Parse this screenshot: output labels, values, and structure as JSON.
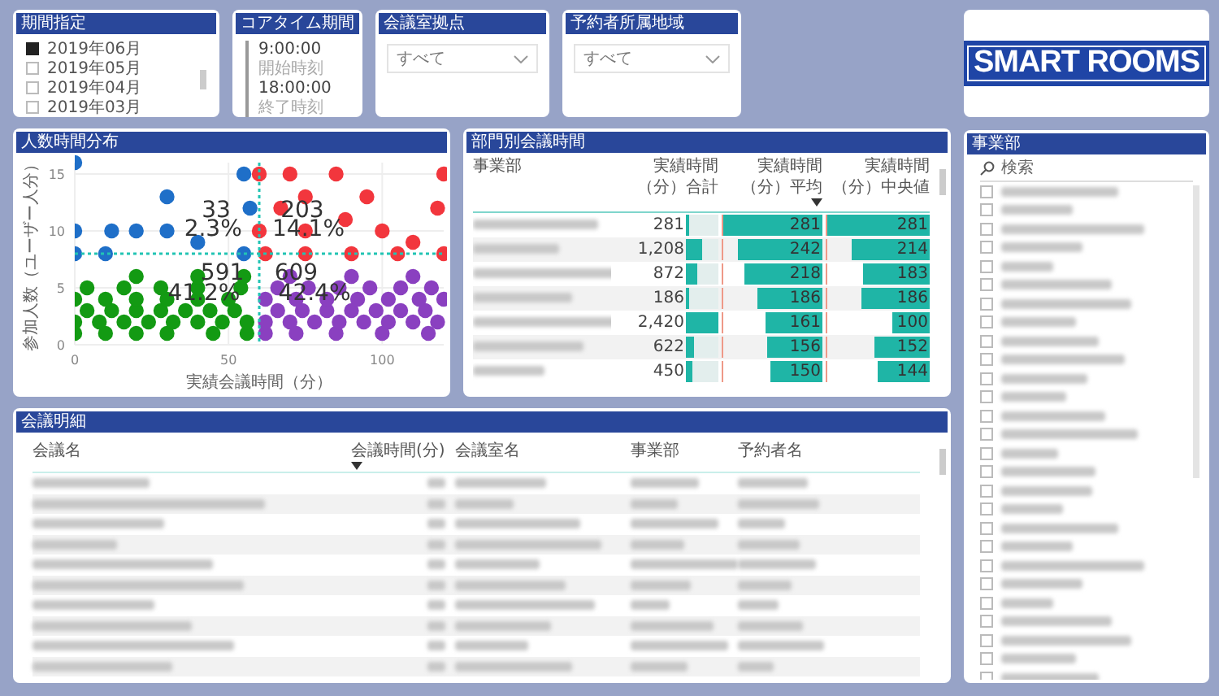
{
  "period_slicer": {
    "title": "期間指定",
    "items": [
      {
        "label": "2019年06月",
        "checked": true
      },
      {
        "label": "2019年05月",
        "checked": false
      },
      {
        "label": "2019年04月",
        "checked": false
      },
      {
        "label": "2019年03月",
        "checked": false
      }
    ]
  },
  "core_time": {
    "title": "コアタイム期間",
    "entries": [
      {
        "value": "9:00:00",
        "label": "開始時刻"
      },
      {
        "value": "18:00:00",
        "label": "終了時刻"
      }
    ]
  },
  "dropdowns": [
    {
      "title": "会議室拠点",
      "value": "すべて"
    },
    {
      "title": "予約者所属地域",
      "value": "すべて"
    }
  ],
  "logo": "SMART ROOMS",
  "scatter_panel": {
    "title": "人数時間分布",
    "chart_data": {
      "type": "scatter",
      "xlabel": "実績会議時間（分）",
      "ylabel": "参加人数（ユーザー人分）",
      "xlim": [
        0,
        120
      ],
      "ylim": [
        0,
        16
      ],
      "xticks": [
        0,
        50,
        100
      ],
      "yticks": [
        0,
        5,
        10,
        15
      ],
      "x": [
        0,
        0,
        0,
        10,
        12,
        20,
        30,
        30,
        40,
        55,
        57,
        55,
        60,
        70,
        85,
        120,
        75,
        95,
        60,
        67,
        75,
        88,
        100,
        110,
        118,
        62,
        75,
        90,
        105,
        120,
        0,
        10,
        20,
        30,
        45,
        56,
        0,
        8,
        16,
        24,
        32,
        40,
        48,
        56,
        4,
        12,
        20,
        28,
        36,
        44,
        52,
        0,
        10,
        20,
        30,
        40,
        50,
        4,
        16,
        28,
        40,
        54,
        20,
        40,
        55,
        62,
        72,
        85,
        100,
        115,
        62,
        70,
        78,
        86,
        94,
        102,
        110,
        118,
        66,
        74,
        82,
        90,
        98,
        106,
        114,
        62,
        72,
        82,
        92,
        102,
        112,
        120,
        66,
        76,
        86,
        96,
        106,
        116,
        70,
        90,
        110
      ],
      "series": [
        {
          "color": "#1f6fc8",
          "values": [
            16,
            10,
            8,
            8,
            10,
            10,
            13,
            10,
            9,
            15,
            12,
            8,
            null,
            null,
            null,
            null,
            null,
            null,
            null,
            null,
            null,
            null,
            null,
            null,
            null,
            null,
            null,
            null,
            null,
            null,
            null,
            null,
            null,
            null,
            null,
            null,
            null,
            null,
            null,
            null,
            null,
            null,
            null,
            null,
            null,
            null,
            null,
            null,
            null,
            null,
            null,
            null,
            null,
            null,
            null,
            null,
            null,
            null,
            null,
            null,
            null,
            null,
            null,
            null,
            null,
            null,
            null,
            null,
            null,
            null,
            null,
            null,
            null,
            null,
            null,
            null,
            null,
            null,
            null,
            null,
            null,
            null,
            null,
            null,
            null,
            null,
            null,
            null,
            null,
            null,
            null,
            null,
            null,
            null,
            null,
            null,
            null,
            null,
            null,
            null,
            null
          ]
        },
        {
          "color": "#f2363d",
          "values": [
            null,
            null,
            null,
            null,
            null,
            null,
            null,
            null,
            null,
            null,
            null,
            null,
            15,
            15,
            15,
            15,
            13,
            13,
            10,
            12,
            10,
            11,
            10,
            9,
            12,
            8,
            8,
            8,
            8,
            8,
            null,
            null,
            null,
            null,
            null,
            null,
            null,
            null,
            null,
            null,
            null,
            null,
            null,
            null,
            null,
            null,
            null,
            null,
            null,
            null,
            null,
            null,
            null,
            null,
            null,
            null,
            null,
            null,
            null,
            null,
            null,
            null,
            null,
            null,
            null,
            null,
            null,
            null,
            null,
            null,
            null,
            null,
            null,
            null,
            null,
            null,
            null,
            null,
            null,
            null,
            null,
            null,
            null,
            null,
            null,
            null,
            null,
            null,
            null,
            null,
            null,
            null,
            null,
            null,
            null,
            null,
            null,
            null,
            null,
            null,
            null
          ]
        },
        {
          "color": "#139a13",
          "values": [
            null,
            null,
            null,
            null,
            null,
            null,
            null,
            null,
            null,
            null,
            null,
            null,
            null,
            null,
            null,
            null,
            null,
            null,
            null,
            null,
            null,
            null,
            null,
            null,
            null,
            null,
            null,
            null,
            null,
            null,
            1,
            1,
            1,
            1,
            1,
            1,
            2,
            2,
            2,
            2,
            2,
            2,
            2,
            2,
            3,
            3,
            3,
            3,
            3,
            3,
            3,
            4,
            4,
            4,
            4,
            4,
            4,
            5,
            5,
            5,
            5,
            5,
            6,
            6,
            6,
            null,
            null,
            null,
            null,
            null,
            null,
            null,
            null,
            null,
            null,
            null,
            null,
            null,
            null,
            null,
            null,
            null,
            null,
            null,
            null,
            null,
            null,
            null,
            null,
            null,
            null,
            null,
            null,
            null,
            null,
            null,
            null,
            null,
            null,
            null,
            null
          ]
        },
        {
          "color": "#8a40c0",
          "values": [
            null,
            null,
            null,
            null,
            null,
            null,
            null,
            null,
            null,
            null,
            null,
            null,
            null,
            null,
            null,
            null,
            null,
            null,
            null,
            null,
            null,
            null,
            null,
            null,
            null,
            null,
            null,
            null,
            null,
            null,
            null,
            null,
            null,
            null,
            null,
            null,
            null,
            null,
            null,
            null,
            null,
            null,
            null,
            null,
            null,
            null,
            null,
            null,
            null,
            null,
            null,
            null,
            null,
            null,
            null,
            null,
            null,
            null,
            null,
            null,
            null,
            null,
            null,
            null,
            null,
            1,
            1,
            1,
            1,
            1,
            2,
            2,
            2,
            2,
            2,
            2,
            2,
            2,
            3,
            3,
            3,
            3,
            3,
            3,
            3,
            4,
            4,
            4,
            4,
            4,
            4,
            4,
            5,
            5,
            5,
            5,
            5,
            5,
            6,
            6,
            6
          ]
        }
      ],
      "grid": true,
      "ref_lines": [
        {
          "axis": "x",
          "value": 60
        },
        {
          "axis": "y",
          "value": 8
        }
      ],
      "annotations": [
        "33",
        "2.3%",
        "203",
        "14.1%",
        "591",
        "41.2%",
        "609",
        "42.4%"
      ]
    }
  },
  "dept_table": {
    "title": "部門別会議時間",
    "columns": [
      {
        "label": "事業部",
        "sorted": false
      },
      {
        "label": "実績時間（分）合計",
        "sorted": false
      },
      {
        "label": "実績時間（分）平均",
        "sorted": true
      },
      {
        "label": "実績時間（分）中央値",
        "sorted": false
      }
    ],
    "rows": [
      {
        "total": {
          "text": "281",
          "level": 0.12
        },
        "average": {
          "text": "281",
          "level": 1
        },
        "median": {
          "text": "281",
          "level": 1
        }
      },
      {
        "total": {
          "text": "1,208",
          "level": 0.5
        },
        "average": {
          "text": "242",
          "level": 0.86
        },
        "median": {
          "text": "214",
          "level": 0.76
        }
      },
      {
        "total": {
          "text": "872",
          "level": 0.36
        },
        "average": {
          "text": "218",
          "level": 0.78
        },
        "median": {
          "text": "183",
          "level": 0.65
        }
      },
      {
        "total": {
          "text": "186",
          "level": 0.08
        },
        "average": {
          "text": "186",
          "level": 0.66
        },
        "median": {
          "text": "186",
          "level": 0.66
        }
      },
      {
        "total": {
          "text": "2,420",
          "level": 1
        },
        "average": {
          "text": "161",
          "level": 0.57
        },
        "median": {
          "text": "100",
          "level": 0.36
        }
      },
      {
        "total": {
          "text": "622",
          "level": 0.26
        },
        "average": {
          "text": "156",
          "level": 0.56
        },
        "median": {
          "text": "152",
          "level": 0.54
        }
      },
      {
        "total": {
          "text": "450",
          "level": 0.19
        },
        "average": {
          "text": "150",
          "level": 0.53
        },
        "median": {
          "text": "144",
          "level": 0.51
        }
      }
    ]
  },
  "detail_table": {
    "title": "会議明細",
    "columns": [
      {
        "label": "会議名",
        "sorted": false
      },
      {
        "label": "会議時間(分)",
        "sorted": true
      },
      {
        "label": "会議室名",
        "sorted": false
      },
      {
        "label": "事業部",
        "sorted": false
      },
      {
        "label": "予約者名",
        "sorted": false
      }
    ]
  },
  "department_slicer": {
    "title": "事業部",
    "search": {
      "placeholder": "検索"
    },
    "items": [
      {
        "checked": false
      },
      {
        "checked": false
      },
      {
        "checked": false
      },
      {
        "checked": false
      },
      {
        "checked": false
      },
      {
        "checked": false
      },
      {
        "checked": false
      },
      {
        "checked": false
      },
      {
        "checked": false
      },
      {
        "checked": false
      },
      {
        "checked": false
      },
      {
        "checked": false
      },
      {
        "checked": false
      },
      {
        "checked": false
      },
      {
        "checked": false
      },
      {
        "checked": false
      },
      {
        "checked": false
      },
      {
        "checked": false
      },
      {
        "checked": false
      },
      {
        "checked": false
      },
      {
        "checked": false
      },
      {
        "checked": false
      },
      {
        "checked": false
      },
      {
        "checked": false
      },
      {
        "checked": false
      },
      {
        "checked": false
      },
      {
        "checked": false
      }
    ]
  }
}
